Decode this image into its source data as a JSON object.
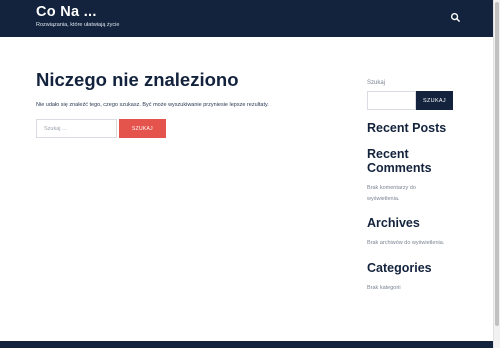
{
  "header": {
    "site_title": "Co Na ...",
    "tagline": "Rozwiązania, które ułatwiają życie",
    "search_icon": "search-icon"
  },
  "main": {
    "title": "Niczego nie znaleziono",
    "message": "Nie udało się znaleźć tego, czego szukasz. Być może wyszukiwanie przyniesie lepsze rezultaty.",
    "search": {
      "placeholder": "Szukaj …",
      "value": "",
      "button_label": "SZUKAJ"
    }
  },
  "sidebar": {
    "search": {
      "label": "Szukaj",
      "value": "",
      "button_label": "SZUKAJ"
    },
    "recent_posts": {
      "title": "Recent Posts"
    },
    "recent_comments": {
      "title_line1": "Recent",
      "title_line2": "Comments",
      "text_line1": "Brak komentarzy do",
      "text_line2": "wyświetlenia."
    },
    "archives": {
      "title": "Archives",
      "text": "Brak archiwów do wyświetlenia."
    },
    "categories": {
      "title": "Categories",
      "text": "Brak kategorii"
    }
  },
  "colors": {
    "header_bg": "#13233d",
    "accent_button": "#e5544c",
    "sidebar_button": "#13233d"
  }
}
